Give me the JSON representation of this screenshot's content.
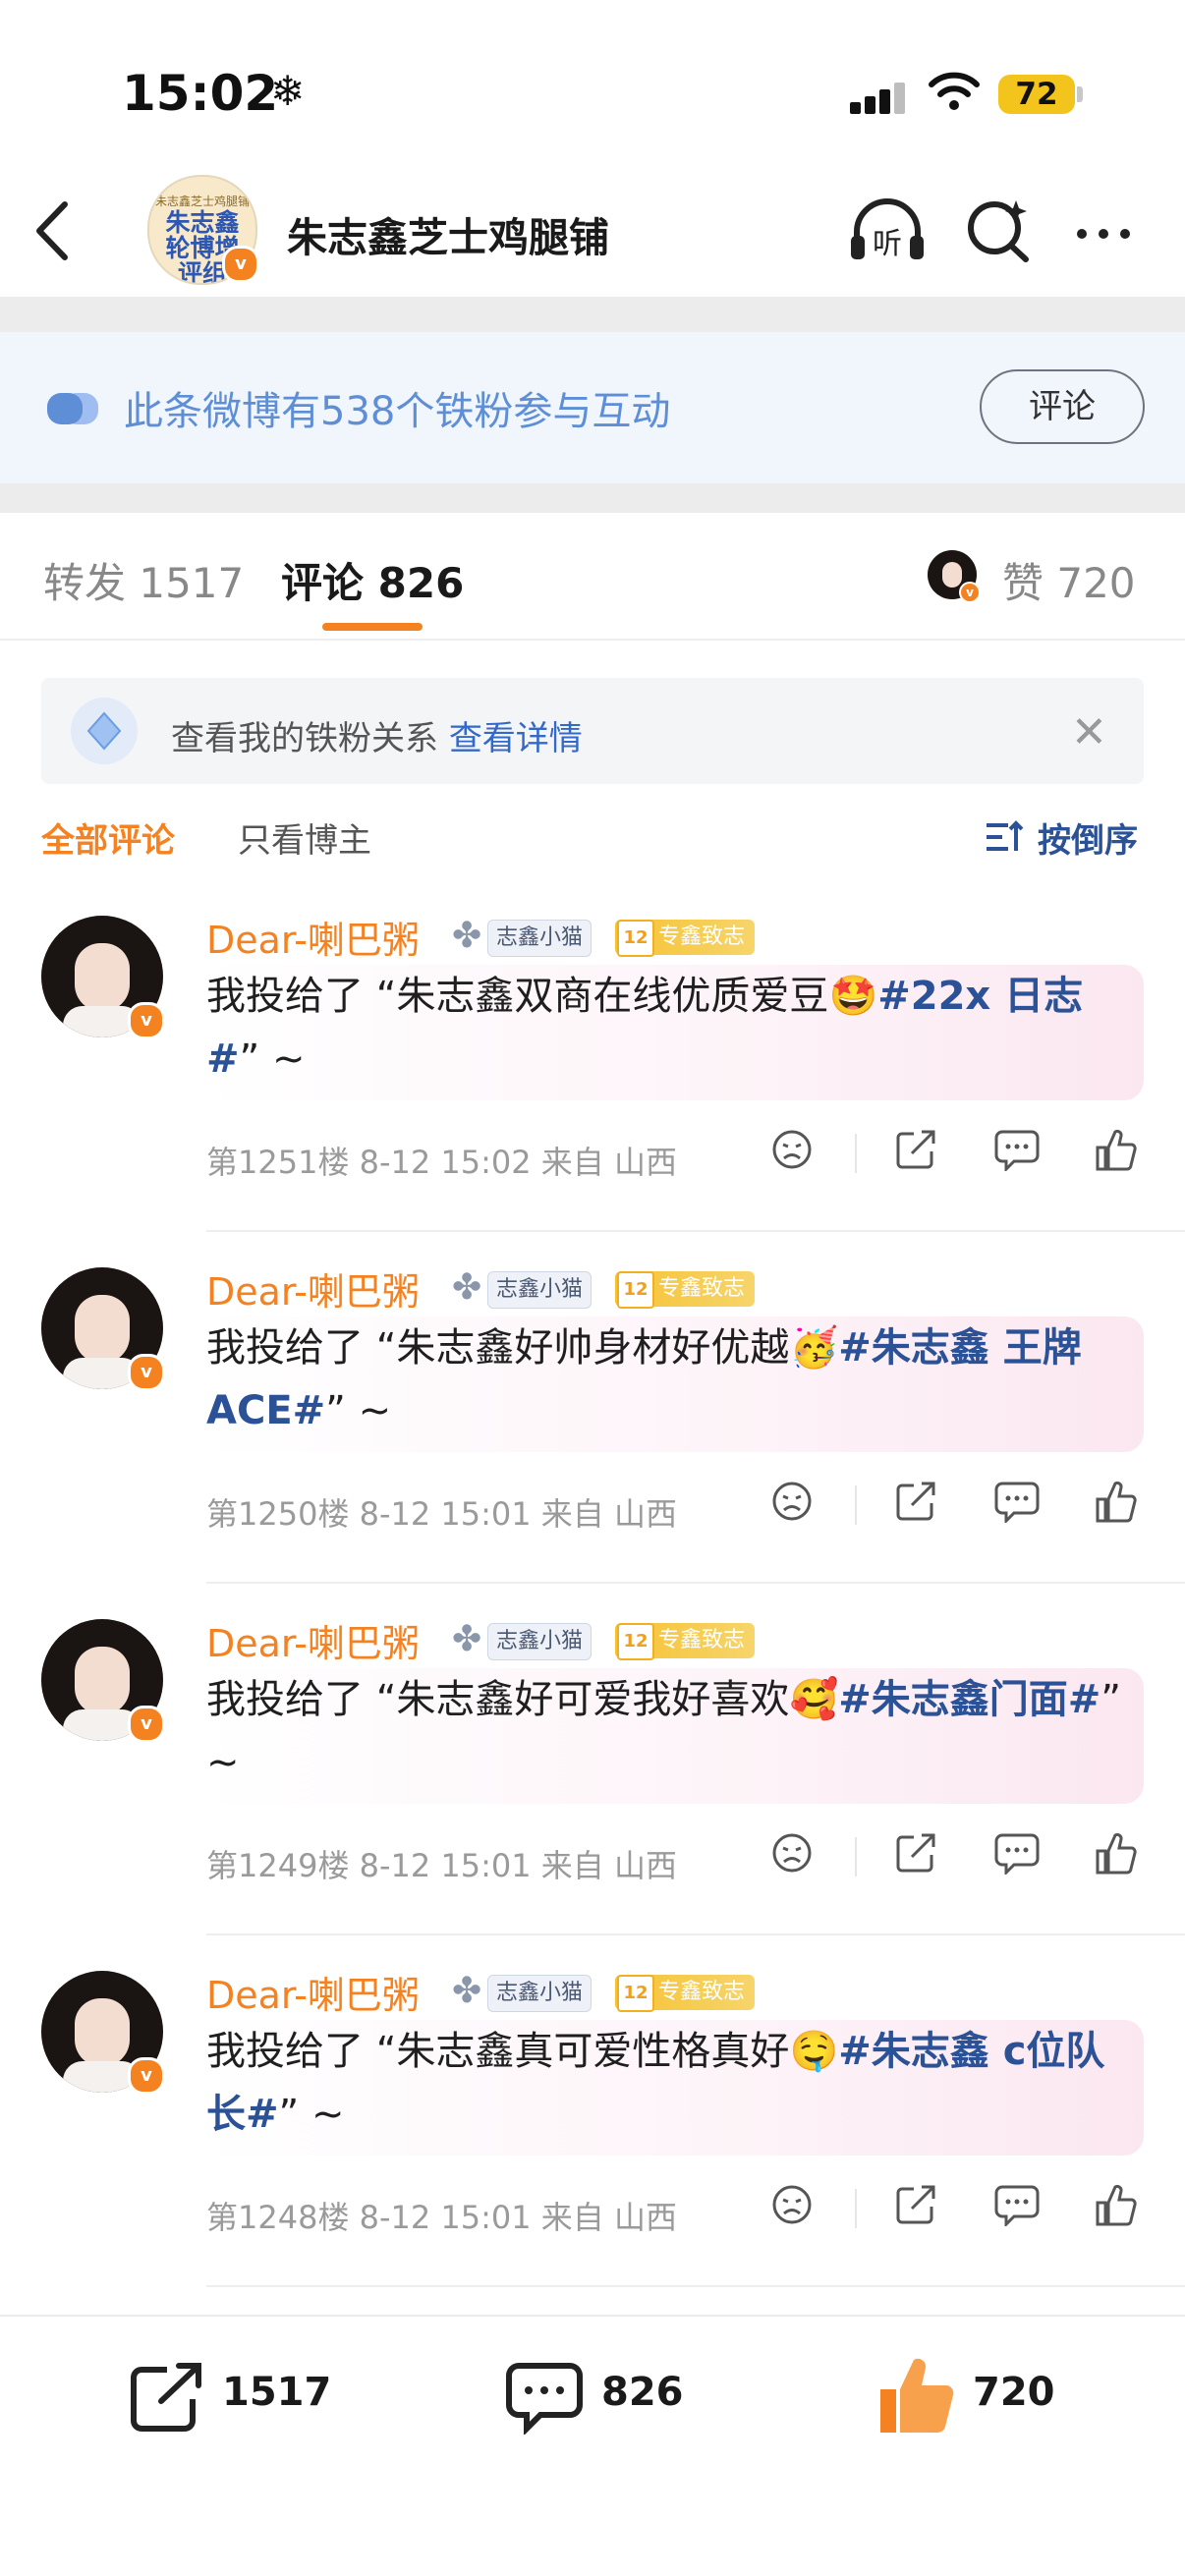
{
  "status_bar": {
    "time": "15:02",
    "weather_icon": "snowflake-icon",
    "battery": "72"
  },
  "nav": {
    "title": "朱志鑫芝士鸡腿铺",
    "avatar_small_text": "朱志鑫芝士鸡腿铺",
    "avatar_text": "朱志鑫轮博增评组",
    "icons": [
      "back-icon",
      "listen-icon",
      "search-icon",
      "more-icon"
    ]
  },
  "banner": {
    "text": "此条微博有538个铁粉参与互动",
    "button": "评论"
  },
  "tabs": {
    "repost": "转发 1517",
    "comments": "评论 826",
    "likes": "赞 720"
  },
  "fan_relation": {
    "text": "查看我的铁粉关系",
    "link": "查看详情"
  },
  "filter": {
    "all": "全部评论",
    "host_only": "只看博主",
    "order": "按倒序"
  },
  "comments": [
    {
      "name": "Dear-喇巴粥",
      "tag1": "志鑫小猫",
      "tag2_level": "12",
      "tag2": "专鑫致志",
      "text": "我投给了 “朱志鑫双商在线优质爱豆",
      "emoji": "🤩",
      "topic": "#22x 日志#",
      "suffix": "” ~",
      "meta": "第1251楼 8-12 15:02 来自 山西"
    },
    {
      "name": "Dear-喇巴粥",
      "tag1": "志鑫小猫",
      "tag2_level": "12",
      "tag2": "专鑫致志",
      "text": "我投给了 “朱志鑫好帅身材好优越",
      "emoji": "🥳",
      "topic": "#朱志鑫 王牌ACE#",
      "suffix": "” ~",
      "meta": "第1250楼 8-12 15:01 来自 山西"
    },
    {
      "name": "Dear-喇巴粥",
      "tag1": "志鑫小猫",
      "tag2_level": "12",
      "tag2": "专鑫致志",
      "text": "我投给了 “朱志鑫好可爱我好喜欢",
      "emoji": "🥰",
      "topic": "#朱志鑫门面#",
      "suffix": "” ~",
      "meta": "第1249楼 8-12 15:01 来自 山西"
    },
    {
      "name": "Dear-喇巴粥",
      "tag1": "志鑫小猫",
      "tag2_level": "12",
      "tag2": "专鑫致志",
      "text": "我投给了 “朱志鑫真可爱性格真好",
      "emoji": "🤤",
      "topic": "#朱志鑫 c位队长#",
      "suffix": "” ~",
      "meta": "第1248楼 8-12 15:01 来自 山西"
    }
  ],
  "bottom_bar": {
    "repost": "1517",
    "comments": "826",
    "likes": "720"
  },
  "colors": {
    "accent": "#f58220",
    "link": "#2b5196",
    "banner_text": "#5e8fd6"
  }
}
